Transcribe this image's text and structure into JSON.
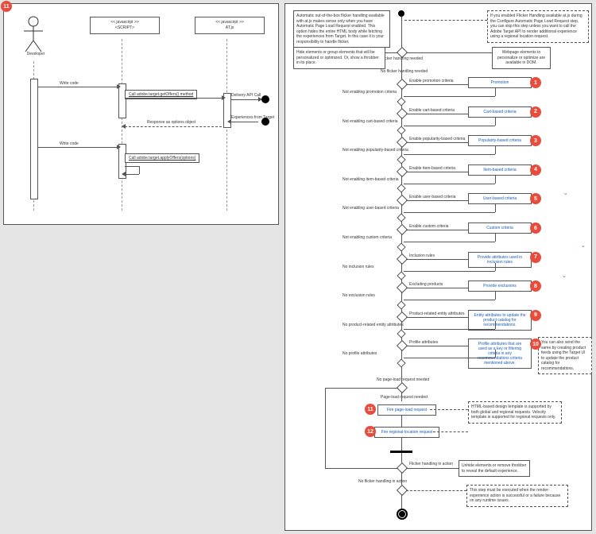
{
  "seq": {
    "badge": "11",
    "actor": "Developer",
    "scriptHead": "<< javascript >>\n<SCRIPT>",
    "atjsHead": "<< javascript >>\nAT.js",
    "msg_write1": "Write code",
    "call1": "Call adobe.target.getOffers() method",
    "api_call": "Delivery API Call",
    "resp_options": "Response as options object",
    "exp_target": "Experiences from Target",
    "msg_write2": "Write code",
    "call2": "Call adobe.target.applyOffers(options)"
  },
  "flow": {
    "note_auto": "Automatic out-of-the-box flicker handling available with at.js makes sense only when you have Automatic Page Load Request enabled. This option hides the entire HTML body while fetching the experiences from Target. In this case it is your responsibility to handle flicker.",
    "note_skip": "If you enabled Flicker Handling available at.js during the Configure Automatic Page Load Request step, you can skip this step unless you want to call the Adobe Target API to render additional experience using a regional location request.",
    "hide_elems": "Hide elements or group elements that will be personalized or optimized. Or, show a throbber in its place.",
    "webpage_elems": "Webpage elements to personalize or optimize are available in DOM.",
    "flicker_needed": "Flicker handling needed",
    "no_flicker": "No flicker handling needed",
    "rows": [
      {
        "on": "Enable promotion criteria",
        "off": "Not enabling promotion criteria",
        "link": "Promotion",
        "n": "1"
      },
      {
        "on": "Enable cart-based criteria",
        "off": "Not enabling cart-based criteria",
        "link": "Cart-based criteria",
        "n": "2"
      },
      {
        "on": "Enable popularity-based criteria",
        "off": "Not enabling popularity-based criteria",
        "link": "Popularity-based criteria",
        "n": "3"
      },
      {
        "on": "Enable item-based criteria",
        "off": "Not enabling item-based criteria",
        "link": "Item-based criteria",
        "n": "4"
      },
      {
        "on": "Enable user-based criteria",
        "off": "Not enabling user-based criteria",
        "link": "User-based criteria",
        "n": "5"
      },
      {
        "on": "Enable custom criteria",
        "off": "Not enabling custom criteria",
        "link": "Custom criteria",
        "n": "6"
      },
      {
        "on": "Inclusion rules",
        "off": "No inclusion rules",
        "link": "Provide attributes used in inclusion rules",
        "n": "7"
      },
      {
        "on": "Excluding products",
        "off": "No exclusion rules",
        "link": "Provide exclusions",
        "n": "8"
      },
      {
        "on": "Product-related entity attributes",
        "off": "No product-related entity attributes",
        "link": "Entity attributes to update the product catalog for recommendations.",
        "n": "9"
      },
      {
        "on": "Profile attributes",
        "off": "No profile attributes",
        "link": "Profile attributes that are used as a key or filtering criteria in any recommendations criteria mentioned above.",
        "n": "10"
      }
    ],
    "note_send": "You can also send the same by creating product feeds using the Target UI to update the product catalog for recommendations.",
    "no_pl": "No page-load request needed",
    "pl_needed": "Page-load request needed",
    "fire_pl": "Fire page-load request",
    "fire_pl_n": "11",
    "fire_rl": "Fire regional-location request",
    "fire_rl_n": "12",
    "html_note": "HTML-based design template is supported by both global and regional requests. Velocity template is supported for regional requests only.",
    "flicker_action": "Flicker handling in action",
    "no_flicker_action": "No flicker handling in action",
    "unhide": "Unhide elements or remove throbber to reveal the default experience.",
    "exec_note": "This step must be executed when the render-experience action is successful or a failure because on any runtime issues."
  }
}
